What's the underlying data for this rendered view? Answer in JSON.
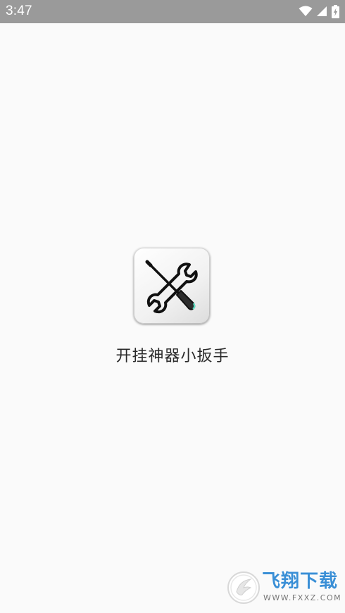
{
  "status_bar": {
    "time": "3:47",
    "background": "#9a9a9a",
    "icons": [
      "wifi-icon",
      "signal-icon",
      "battery-charging-icon"
    ]
  },
  "splash": {
    "app_name": "开挂神器小扳手",
    "app_icon": "wrench-screwdriver-icon",
    "background": "#fafafa"
  },
  "watermark": {
    "title": "飞翔下载",
    "url": "WWW.FXXZ.COM",
    "accent": "#3a8fd6"
  }
}
